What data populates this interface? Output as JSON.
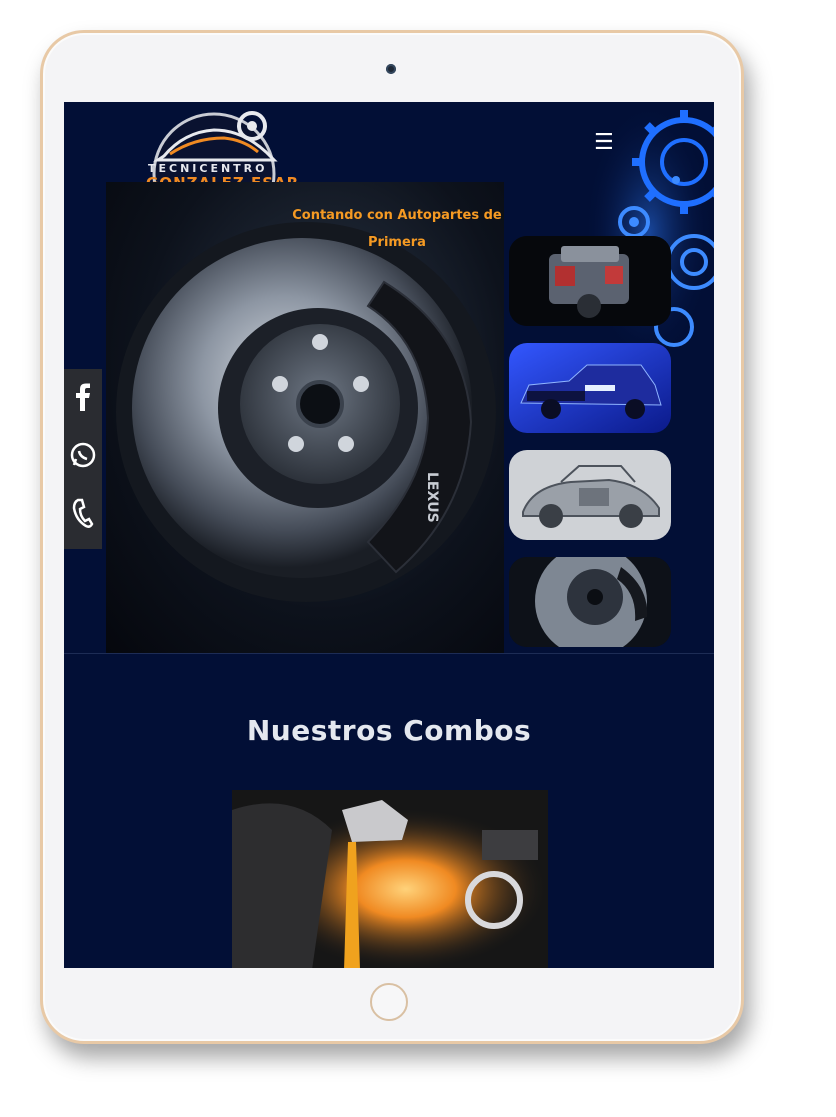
{
  "logo": {
    "brand_top": "TECNICENTRO",
    "brand_name": "GONZALEZ ESAR"
  },
  "hero": {
    "caption": "Contando con Autopartes de Primera",
    "caliper_text": "LEXUS"
  },
  "section": {
    "title": "Nuestros Combos"
  },
  "menu_icon": "☰",
  "social": [
    {
      "name": "facebook-icon"
    },
    {
      "name": "whatsapp-icon"
    },
    {
      "name": "phone-icon"
    }
  ],
  "thumbnails": [
    {
      "name": "engine-thumbnail"
    },
    {
      "name": "pickup-truck-thumbnail"
    },
    {
      "name": "car-xray-thumbnail"
    },
    {
      "name": "brake-disc-thumbnail"
    }
  ],
  "colors": {
    "screen_bg": "#020f36",
    "accent_orange": "#f59a23",
    "frame_gold": "#e8c9a6"
  }
}
